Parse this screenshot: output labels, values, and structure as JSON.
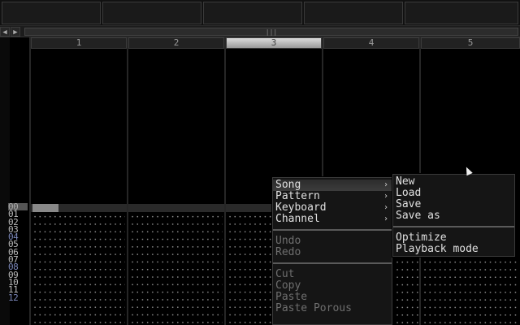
{
  "channels": [
    {
      "label": "1"
    },
    {
      "label": "2"
    },
    {
      "label": "3"
    },
    {
      "label": "4"
    },
    {
      "label": "5"
    }
  ],
  "row_numbers": [
    "00",
    "01",
    "02",
    "03",
    "04",
    "05",
    "06",
    "07",
    "08",
    "09",
    "10",
    "11",
    "12"
  ],
  "scrollbar": {
    "left_arrow": "◀",
    "right_arrow": "▶",
    "grip": "|||"
  },
  "menu": {
    "items": [
      {
        "label": "Song"
      },
      {
        "label": "Pattern"
      },
      {
        "label": "Keyboard"
      },
      {
        "label": "Channel"
      },
      {
        "label": "Undo"
      },
      {
        "label": "Redo"
      },
      {
        "label": "Cut"
      },
      {
        "label": "Copy"
      },
      {
        "label": "Paste"
      },
      {
        "label": "Paste Porous"
      }
    ],
    "submenu_arrow": "›"
  },
  "submenu": {
    "items": [
      {
        "label": "New"
      },
      {
        "label": "Load"
      },
      {
        "label": "Save"
      },
      {
        "label": "Save as"
      },
      {
        "label": "Optimize"
      },
      {
        "label": "Playback mode"
      }
    ]
  }
}
